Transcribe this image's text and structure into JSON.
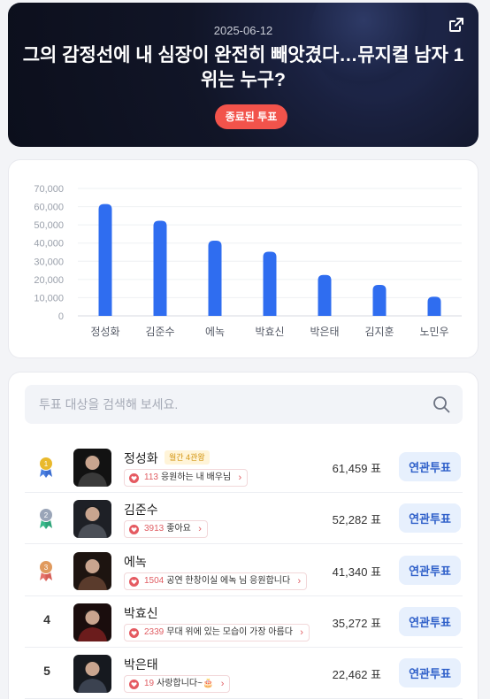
{
  "header": {
    "date": "2025-06-12",
    "title": "그의 감정선에 내 심장이 완전히 빼앗겼다…뮤지컬 남자 1위는 누구?",
    "status": "종료된 투표",
    "share_icon": "share-icon"
  },
  "chart_data": {
    "type": "bar",
    "categories": [
      "정성화",
      "김준수",
      "에녹",
      "박효신",
      "박은태",
      "김지훈",
      "노민우"
    ],
    "values": [
      61459,
      52282,
      41340,
      35272,
      22462,
      17000,
      10500
    ],
    "yticks": [
      "0",
      "10,000",
      "20,000",
      "30,000",
      "40,000",
      "50,000",
      "60,000",
      "70,000"
    ],
    "ylim": [
      0,
      70000
    ],
    "bar_color": "#2f6df0",
    "grid": true
  },
  "search": {
    "placeholder": "투표 대상을 검색해 보세요.",
    "value": ""
  },
  "candidates": [
    {
      "rank": "1",
      "name": "정성화",
      "badge": "월간 4관왕",
      "cheer_count": "113",
      "cheer_text": "응원하는 내 배우님",
      "votes": "61,459 표",
      "button": "연관투표",
      "medal_color": "#e9b92c"
    },
    {
      "rank": "2",
      "name": "김준수",
      "badge": "",
      "cheer_count": "3913",
      "cheer_text": "좋아요",
      "votes": "52,282 표",
      "button": "연관투표",
      "medal_color": "#9aa5b8"
    },
    {
      "rank": "3",
      "name": "에녹",
      "badge": "",
      "cheer_count": "1504",
      "cheer_text": "공연 한창이실 에녹 님 응원합니다",
      "votes": "41,340 표",
      "button": "연관투표",
      "medal_color": "#e09a5e"
    },
    {
      "rank": "4",
      "name": "박효신",
      "badge": "",
      "cheer_count": "2339",
      "cheer_text": "무대 위에 있는 모습이 가장 아름다",
      "votes": "35,272 표",
      "button": "연관투표"
    },
    {
      "rank": "5",
      "name": "박은태",
      "badge": "",
      "cheer_count": "19",
      "cheer_text": "사랑합니다~🎂",
      "votes": "22,462 표",
      "button": "연관투표"
    }
  ]
}
